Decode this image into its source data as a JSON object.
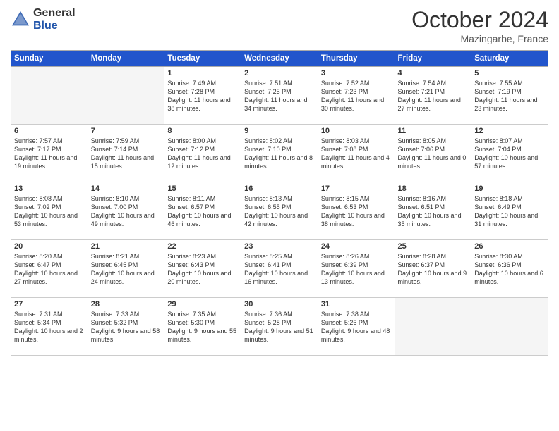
{
  "header": {
    "logo_general": "General",
    "logo_blue": "Blue",
    "month_title": "October 2024",
    "subtitle": "Mazingarbe, France"
  },
  "weekdays": [
    "Sunday",
    "Monday",
    "Tuesday",
    "Wednesday",
    "Thursday",
    "Friday",
    "Saturday"
  ],
  "weeks": [
    [
      {
        "day": "",
        "info": ""
      },
      {
        "day": "",
        "info": ""
      },
      {
        "day": "1",
        "info": "Sunrise: 7:49 AM\nSunset: 7:28 PM\nDaylight: 11 hours and 38 minutes."
      },
      {
        "day": "2",
        "info": "Sunrise: 7:51 AM\nSunset: 7:25 PM\nDaylight: 11 hours and 34 minutes."
      },
      {
        "day": "3",
        "info": "Sunrise: 7:52 AM\nSunset: 7:23 PM\nDaylight: 11 hours and 30 minutes."
      },
      {
        "day": "4",
        "info": "Sunrise: 7:54 AM\nSunset: 7:21 PM\nDaylight: 11 hours and 27 minutes."
      },
      {
        "day": "5",
        "info": "Sunrise: 7:55 AM\nSunset: 7:19 PM\nDaylight: 11 hours and 23 minutes."
      }
    ],
    [
      {
        "day": "6",
        "info": "Sunrise: 7:57 AM\nSunset: 7:17 PM\nDaylight: 11 hours and 19 minutes."
      },
      {
        "day": "7",
        "info": "Sunrise: 7:59 AM\nSunset: 7:14 PM\nDaylight: 11 hours and 15 minutes."
      },
      {
        "day": "8",
        "info": "Sunrise: 8:00 AM\nSunset: 7:12 PM\nDaylight: 11 hours and 12 minutes."
      },
      {
        "day": "9",
        "info": "Sunrise: 8:02 AM\nSunset: 7:10 PM\nDaylight: 11 hours and 8 minutes."
      },
      {
        "day": "10",
        "info": "Sunrise: 8:03 AM\nSunset: 7:08 PM\nDaylight: 11 hours and 4 minutes."
      },
      {
        "day": "11",
        "info": "Sunrise: 8:05 AM\nSunset: 7:06 PM\nDaylight: 11 hours and 0 minutes."
      },
      {
        "day": "12",
        "info": "Sunrise: 8:07 AM\nSunset: 7:04 PM\nDaylight: 10 hours and 57 minutes."
      }
    ],
    [
      {
        "day": "13",
        "info": "Sunrise: 8:08 AM\nSunset: 7:02 PM\nDaylight: 10 hours and 53 minutes."
      },
      {
        "day": "14",
        "info": "Sunrise: 8:10 AM\nSunset: 7:00 PM\nDaylight: 10 hours and 49 minutes."
      },
      {
        "day": "15",
        "info": "Sunrise: 8:11 AM\nSunset: 6:57 PM\nDaylight: 10 hours and 46 minutes."
      },
      {
        "day": "16",
        "info": "Sunrise: 8:13 AM\nSunset: 6:55 PM\nDaylight: 10 hours and 42 minutes."
      },
      {
        "day": "17",
        "info": "Sunrise: 8:15 AM\nSunset: 6:53 PM\nDaylight: 10 hours and 38 minutes."
      },
      {
        "day": "18",
        "info": "Sunrise: 8:16 AM\nSunset: 6:51 PM\nDaylight: 10 hours and 35 minutes."
      },
      {
        "day": "19",
        "info": "Sunrise: 8:18 AM\nSunset: 6:49 PM\nDaylight: 10 hours and 31 minutes."
      }
    ],
    [
      {
        "day": "20",
        "info": "Sunrise: 8:20 AM\nSunset: 6:47 PM\nDaylight: 10 hours and 27 minutes."
      },
      {
        "day": "21",
        "info": "Sunrise: 8:21 AM\nSunset: 6:45 PM\nDaylight: 10 hours and 24 minutes."
      },
      {
        "day": "22",
        "info": "Sunrise: 8:23 AM\nSunset: 6:43 PM\nDaylight: 10 hours and 20 minutes."
      },
      {
        "day": "23",
        "info": "Sunrise: 8:25 AM\nSunset: 6:41 PM\nDaylight: 10 hours and 16 minutes."
      },
      {
        "day": "24",
        "info": "Sunrise: 8:26 AM\nSunset: 6:39 PM\nDaylight: 10 hours and 13 minutes."
      },
      {
        "day": "25",
        "info": "Sunrise: 8:28 AM\nSunset: 6:37 PM\nDaylight: 10 hours and 9 minutes."
      },
      {
        "day": "26",
        "info": "Sunrise: 8:30 AM\nSunset: 6:36 PM\nDaylight: 10 hours and 6 minutes."
      }
    ],
    [
      {
        "day": "27",
        "info": "Sunrise: 7:31 AM\nSunset: 5:34 PM\nDaylight: 10 hours and 2 minutes."
      },
      {
        "day": "28",
        "info": "Sunrise: 7:33 AM\nSunset: 5:32 PM\nDaylight: 9 hours and 58 minutes."
      },
      {
        "day": "29",
        "info": "Sunrise: 7:35 AM\nSunset: 5:30 PM\nDaylight: 9 hours and 55 minutes."
      },
      {
        "day": "30",
        "info": "Sunrise: 7:36 AM\nSunset: 5:28 PM\nDaylight: 9 hours and 51 minutes."
      },
      {
        "day": "31",
        "info": "Sunrise: 7:38 AM\nSunset: 5:26 PM\nDaylight: 9 hours and 48 minutes."
      },
      {
        "day": "",
        "info": ""
      },
      {
        "day": "",
        "info": ""
      }
    ]
  ]
}
